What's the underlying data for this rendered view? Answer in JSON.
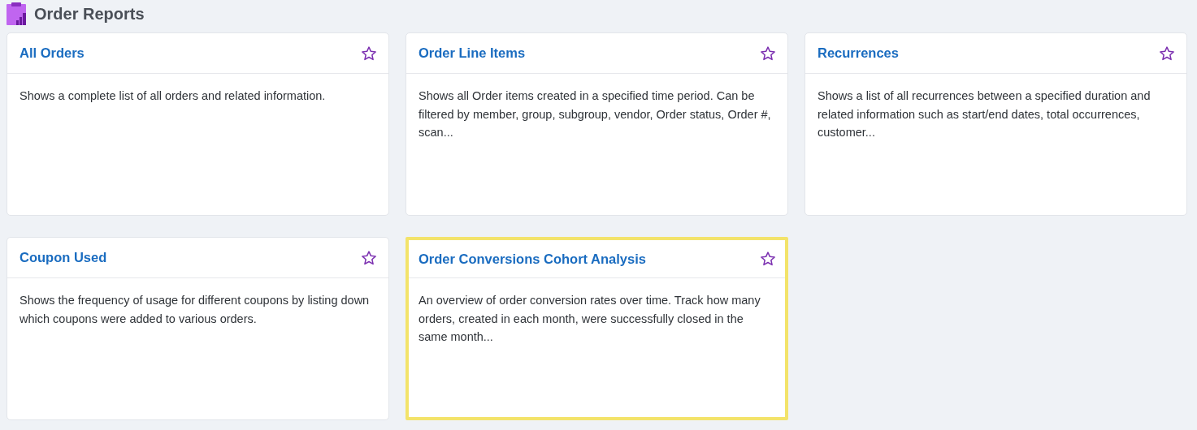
{
  "page": {
    "title": "Order Reports"
  },
  "reports": [
    {
      "title": "All Orders",
      "description": "Shows a complete list of all orders and related information.",
      "favorite": false,
      "highlighted": false
    },
    {
      "title": "Order Line Items",
      "description": "Shows all Order items created in a specified time period. Can be filtered by member, group, subgroup, vendor, Order status, Order #, scan...",
      "favorite": false,
      "highlighted": false
    },
    {
      "title": "Recurrences",
      "description": "Shows a list of all recurrences between a specified duration and related information such as start/end dates, total occurrences, customer...",
      "favorite": false,
      "highlighted": false
    },
    {
      "title": "Coupon Used",
      "description": "Shows the frequency of usage for different coupons by listing down which coupons were added to various orders.",
      "favorite": false,
      "highlighted": false
    },
    {
      "title": "Order Conversions Cohort Analysis",
      "description": "An overview of order conversion rates over time. Track how many orders, created in each month, were successfully closed in the same month...",
      "favorite": false,
      "highlighted": true
    }
  ]
}
